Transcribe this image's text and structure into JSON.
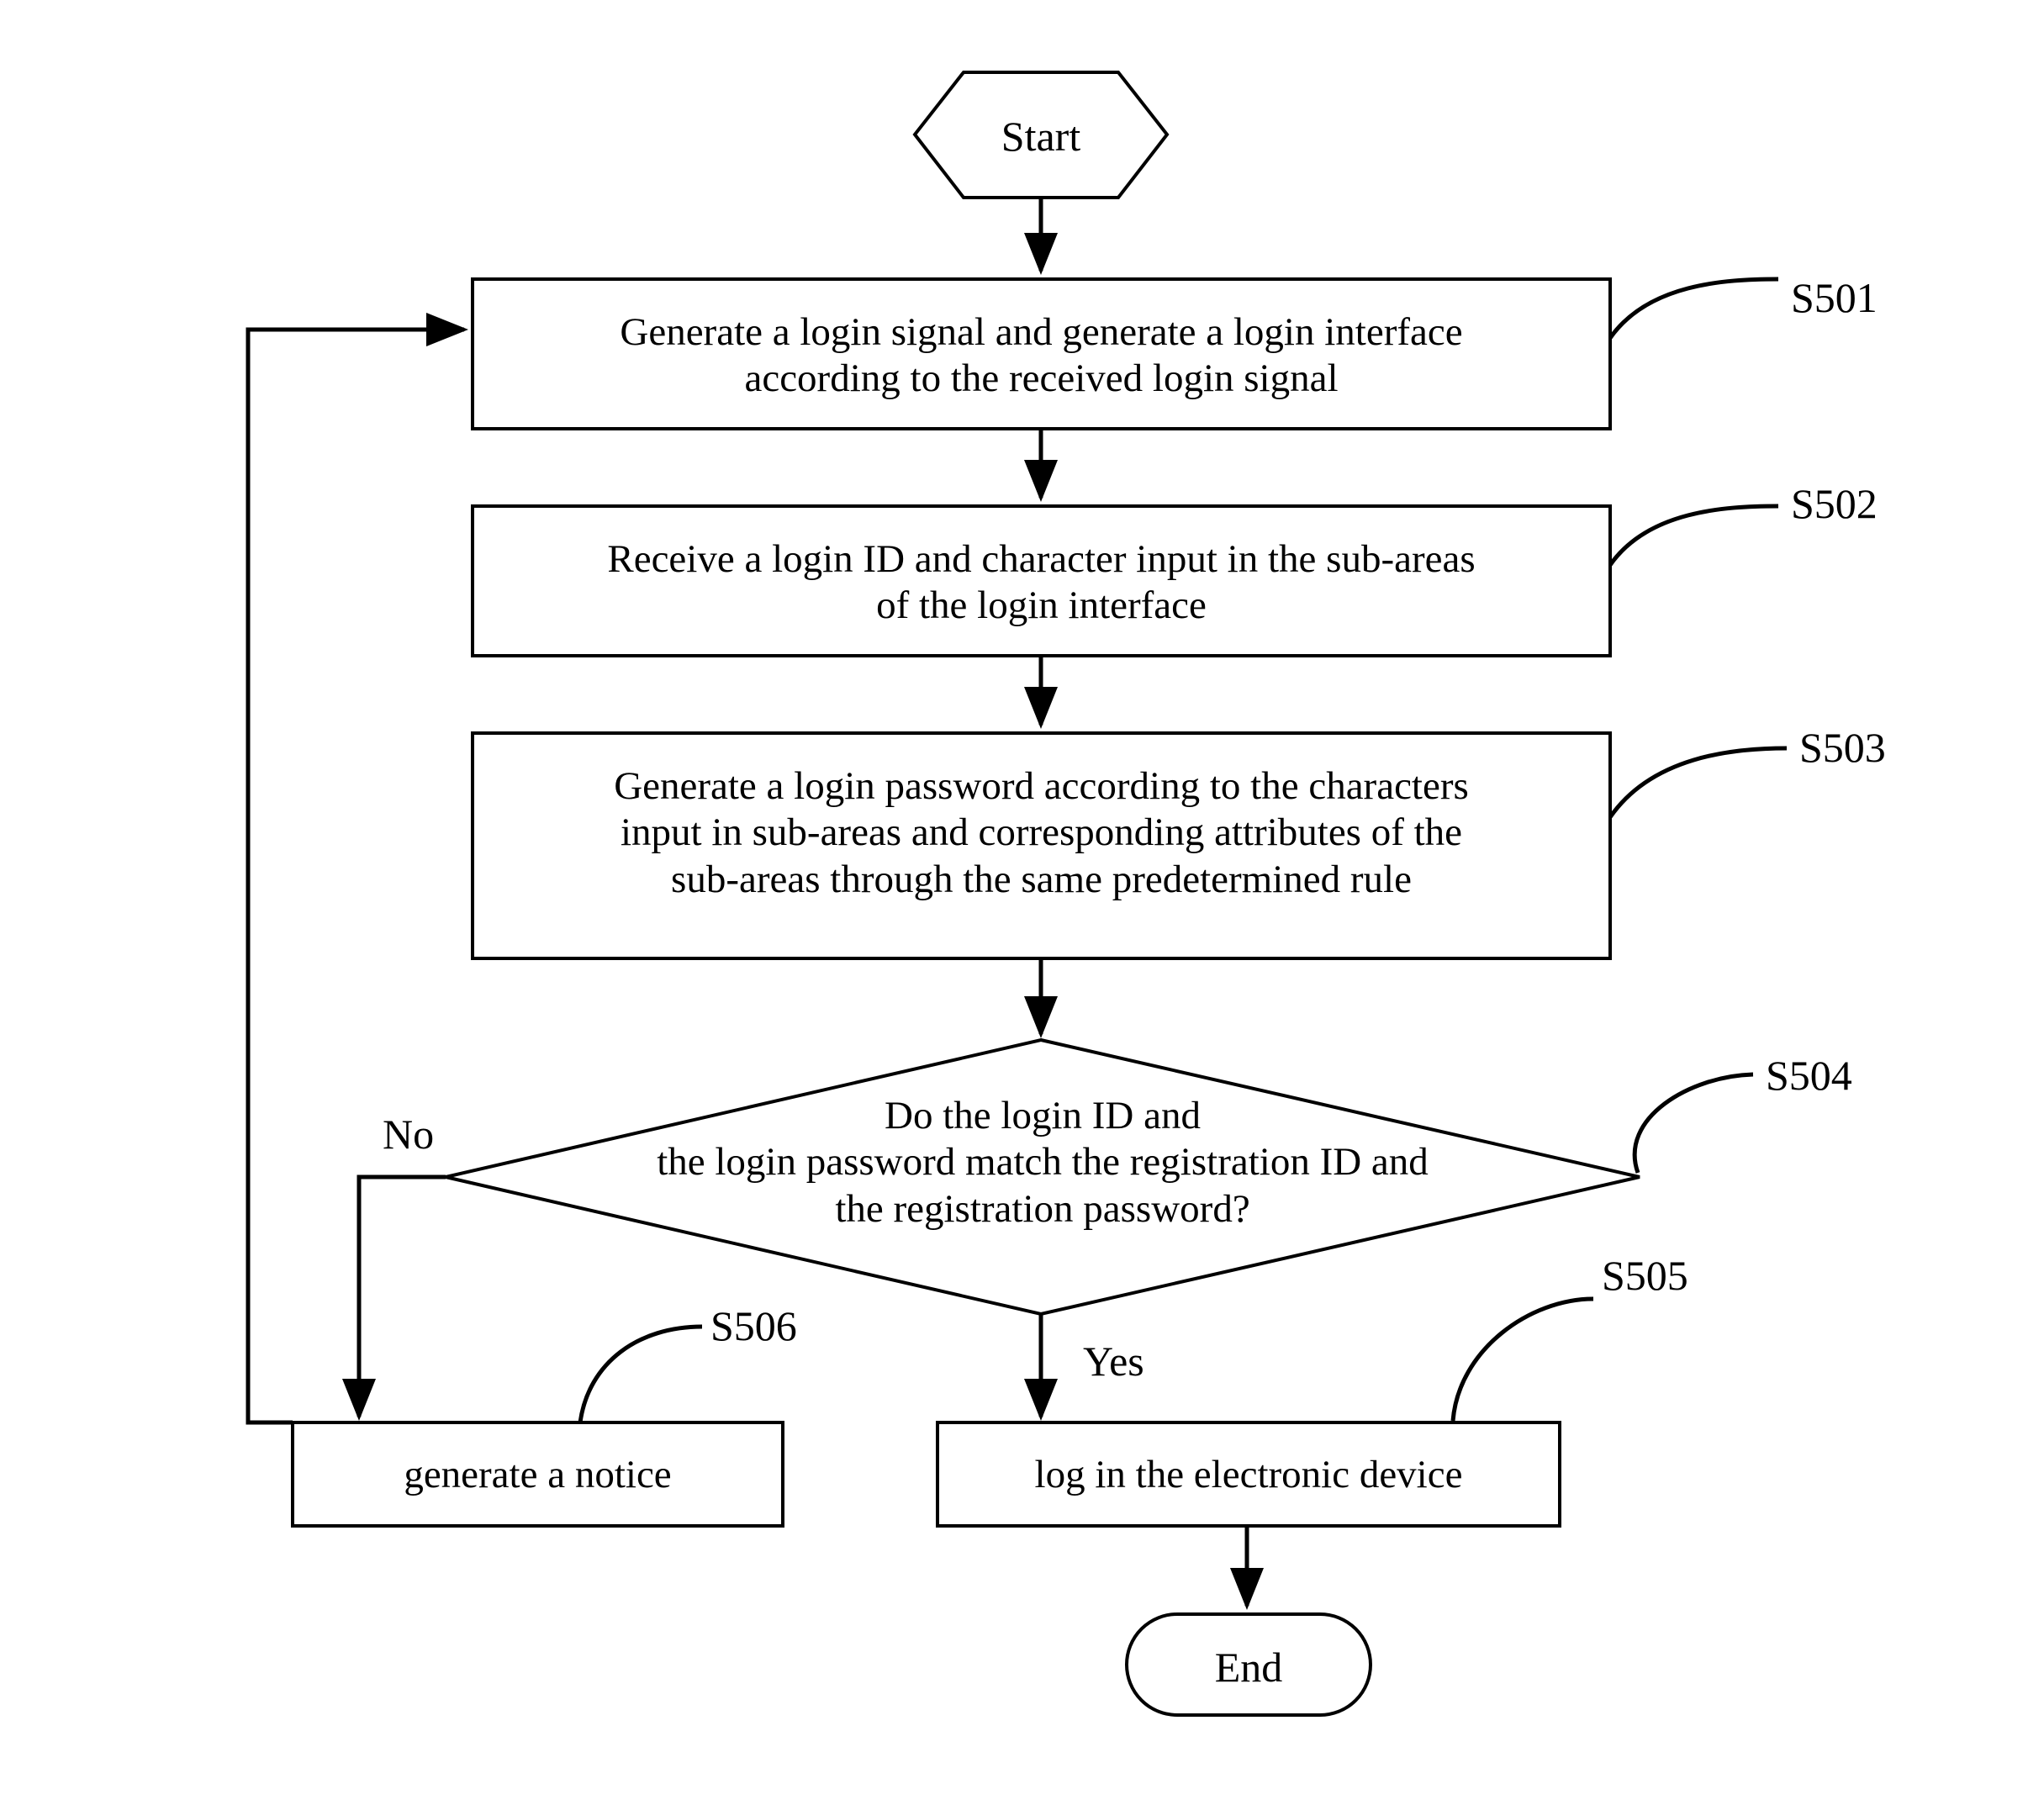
{
  "diagram": {
    "type": "flowchart",
    "title": "",
    "nodes": [
      {
        "id": "start",
        "shape": "hexagon",
        "label": "Start"
      },
      {
        "id": "s501",
        "shape": "process",
        "label": "Generate a login signal and generate a login interface\naccording to the received login signal",
        "step": "S501"
      },
      {
        "id": "s502",
        "shape": "process",
        "label": "Receive a login ID and character input in the sub-areas\nof the login interface",
        "step": "S502"
      },
      {
        "id": "s503",
        "shape": "process",
        "label": "Generate a login password according to the characters\ninput in sub-areas and corresponding attributes of the\nsub-areas through the same predetermined rule",
        "step": "S503"
      },
      {
        "id": "s504",
        "shape": "decision",
        "label": "Do the login ID and\nthe login password match the registration ID and\nthe registration password?",
        "step": "S504"
      },
      {
        "id": "s506",
        "shape": "process",
        "label": "generate a notice",
        "step": "S506"
      },
      {
        "id": "s505",
        "shape": "process",
        "label": "log in the electronic device",
        "step": "S505"
      },
      {
        "id": "end",
        "shape": "stadium",
        "label": "End"
      }
    ],
    "branch_labels": {
      "no": "No",
      "yes": "Yes"
    },
    "step_labels": {
      "s501": "S501",
      "s502": "S502",
      "s503": "S503",
      "s504": "S504",
      "s505": "S505",
      "s506": "S506"
    },
    "colors": {
      "stroke": "#000000",
      "fill": "#ffffff",
      "text": "#000000"
    }
  }
}
